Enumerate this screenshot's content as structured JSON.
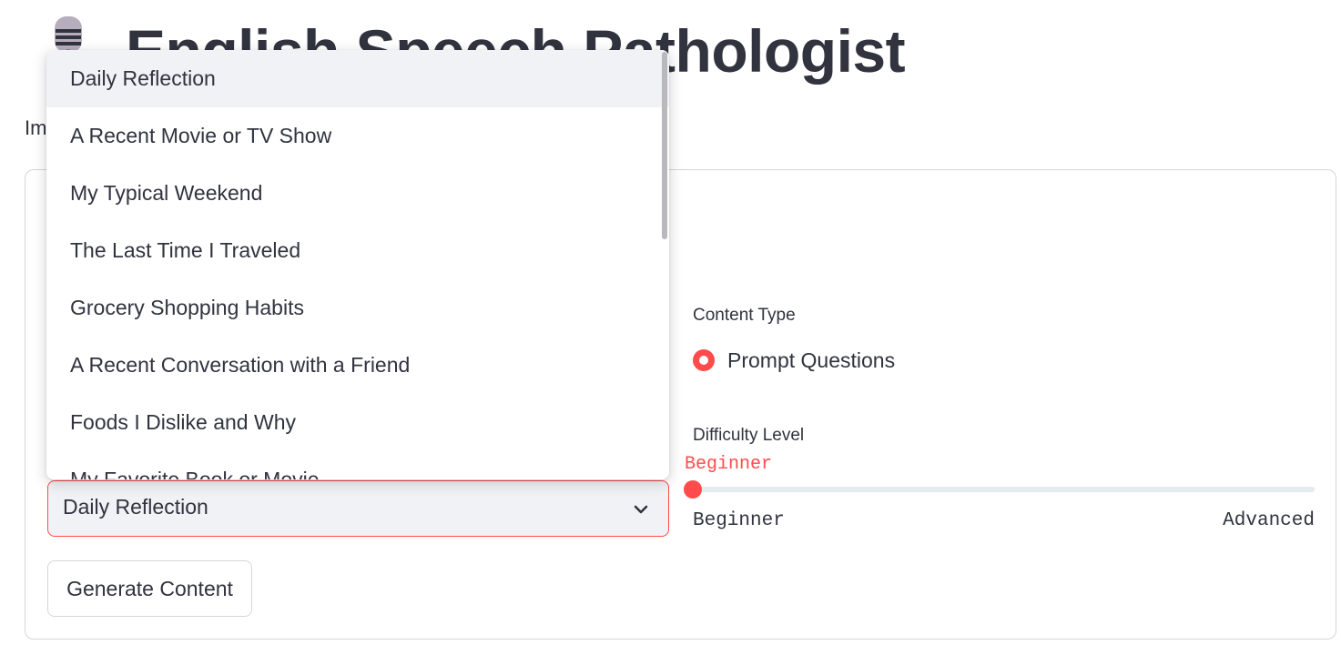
{
  "header": {
    "title": "English Speech Pathologist",
    "icon": "microphone-icon",
    "intro_text_visible": "Im"
  },
  "topic_select": {
    "selected_value": "Daily Reflection",
    "options": [
      "Daily Reflection",
      "A Recent Movie or TV Show",
      "My Typical Weekend",
      "The Last Time I Traveled",
      "Grocery Shopping Habits",
      "A Recent Conversation with a Friend",
      "Foods I Dislike and Why",
      "My Favorite Book or Movie"
    ]
  },
  "content_type": {
    "label": "Content Type",
    "options": [
      "Prompt Questions"
    ],
    "selected": "Prompt Questions"
  },
  "difficulty": {
    "label": "Difficulty Level",
    "current_value": "Beginner",
    "min_label": "Beginner",
    "max_label": "Advanced",
    "level": 0
  },
  "actions": {
    "generate_label": "Generate Content"
  },
  "colors": {
    "accent": "#ff4b4b",
    "text": "#31333f",
    "select_bg": "#f0f2f6",
    "border": "#d6d6d9"
  }
}
